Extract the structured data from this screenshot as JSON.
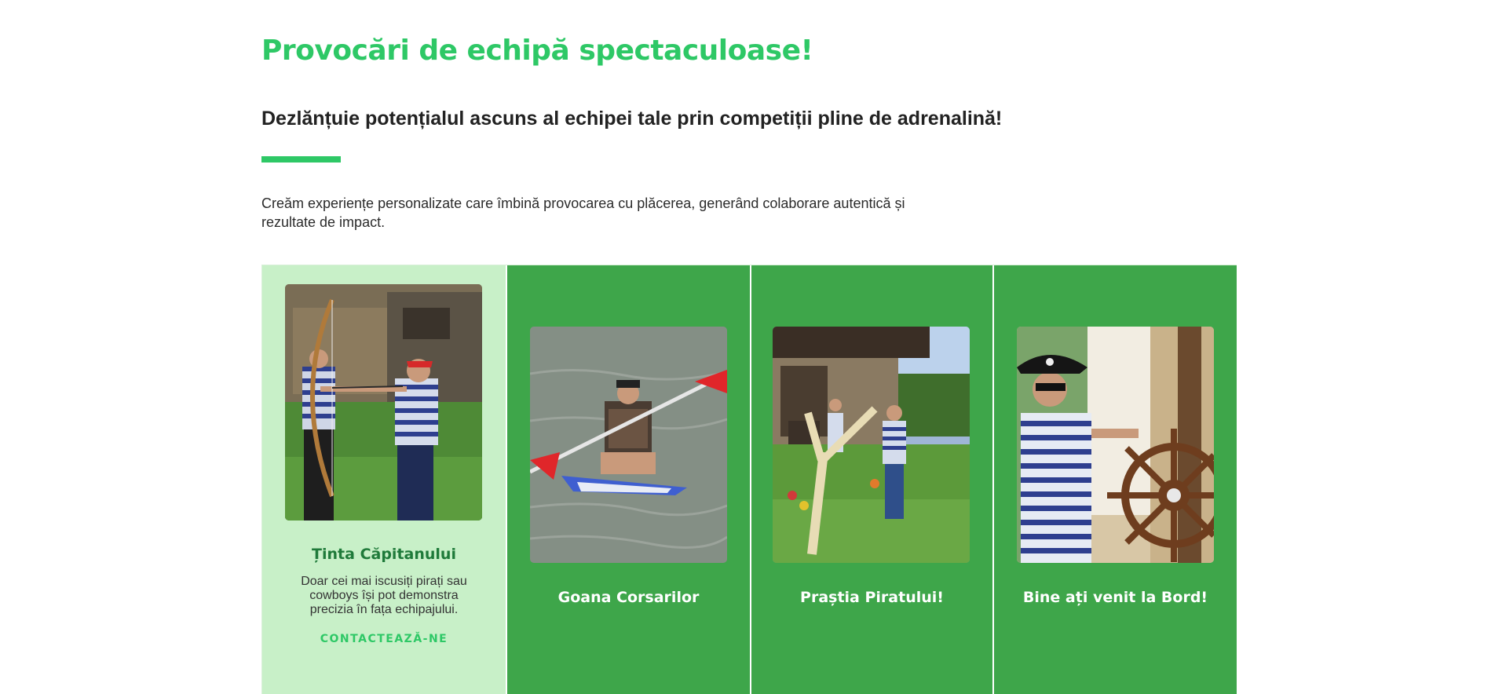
{
  "header": {
    "title": "Provocări de echipă spectaculoase!",
    "subtitle": "Dezlănțuie potențialul ascuns al echipei tale prin competiții pline de adrenalină!",
    "description": "Creăm experiențe personalizate care îmbină provocarea cu plăcerea, generând colaborare autentică și rezultate de impact."
  },
  "colors": {
    "accent": "#2ec866",
    "card_active_bg": "#c8f0c8",
    "card_bg": "#3ea64a",
    "active_title": "#1f7a3a"
  },
  "cards": [
    {
      "title": "Ținta Căpitanului",
      "text": "Doar cei mai iscusiți pirați sau cowboys își pot demonstra precizia în fața echipajului.",
      "link": "CONTACTEAZĂ-NE",
      "photo_icon": "archery-photo"
    },
    {
      "title": "Goana Corsarilor",
      "photo_icon": "kayak-photo"
    },
    {
      "title": "Praștia Piratului!",
      "photo_icon": "slingshot-photo"
    },
    {
      "title": "Bine ați venit la Bord!",
      "photo_icon": "pirate-ship-wheel-photo"
    }
  ]
}
